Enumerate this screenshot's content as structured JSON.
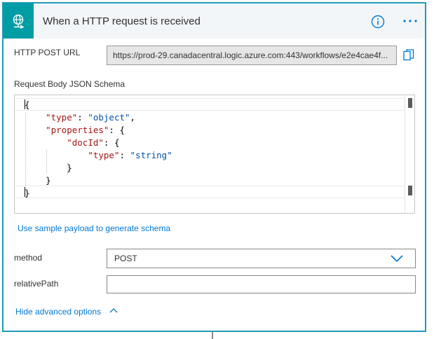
{
  "colors": {
    "accent": "#1e9bb8",
    "icon_bg": "#009da5",
    "link": "#0078d4",
    "json_key": "#a31515",
    "json_string": "#0451a5"
  },
  "header": {
    "title": "When a HTTP request is received",
    "trigger_icon": "globe-request-icon",
    "info_icon": "info-icon",
    "more_icon": "ellipsis-icon"
  },
  "http_post_url": {
    "label": "HTTP POST URL",
    "value": "https://prod-29.canadacentral.logic.azure.com:443/workflows/e2e4cae4f...",
    "copy_icon": "copy-icon"
  },
  "schema": {
    "label": "Request Body JSON Schema",
    "lines": [
      [
        {
          "t": "{",
          "c": "punc"
        }
      ],
      [
        {
          "t": "    ",
          "c": "punc"
        },
        {
          "t": "\"type\"",
          "c": "key"
        },
        {
          "t": ": ",
          "c": "punc"
        },
        {
          "t": "\"object\"",
          "c": "str"
        },
        {
          "t": ",",
          "c": "punc"
        }
      ],
      [
        {
          "t": "    ",
          "c": "punc"
        },
        {
          "t": "\"properties\"",
          "c": "key"
        },
        {
          "t": ": {",
          "c": "punc"
        }
      ],
      [
        {
          "t": "        ",
          "c": "punc"
        },
        {
          "t": "\"docId\"",
          "c": "key"
        },
        {
          "t": ": {",
          "c": "punc"
        }
      ],
      [
        {
          "t": "            ",
          "c": "punc"
        },
        {
          "t": "\"type\"",
          "c": "key"
        },
        {
          "t": ": ",
          "c": "punc"
        },
        {
          "t": "\"string\"",
          "c": "str"
        }
      ],
      [
        {
          "t": "        }",
          "c": "punc"
        }
      ],
      [
        {
          "t": "    }",
          "c": "punc"
        }
      ],
      [
        {
          "t": "}",
          "c": "punc"
        }
      ]
    ]
  },
  "sample_payload_link": "Use sample payload to generate schema",
  "method": {
    "label": "method",
    "value": "POST",
    "chevron_icon": "chevron-down-icon"
  },
  "relative_path": {
    "label": "relativePath",
    "value": ""
  },
  "advanced": {
    "label": "Hide advanced options",
    "chevron_icon": "chevron-up-icon"
  }
}
